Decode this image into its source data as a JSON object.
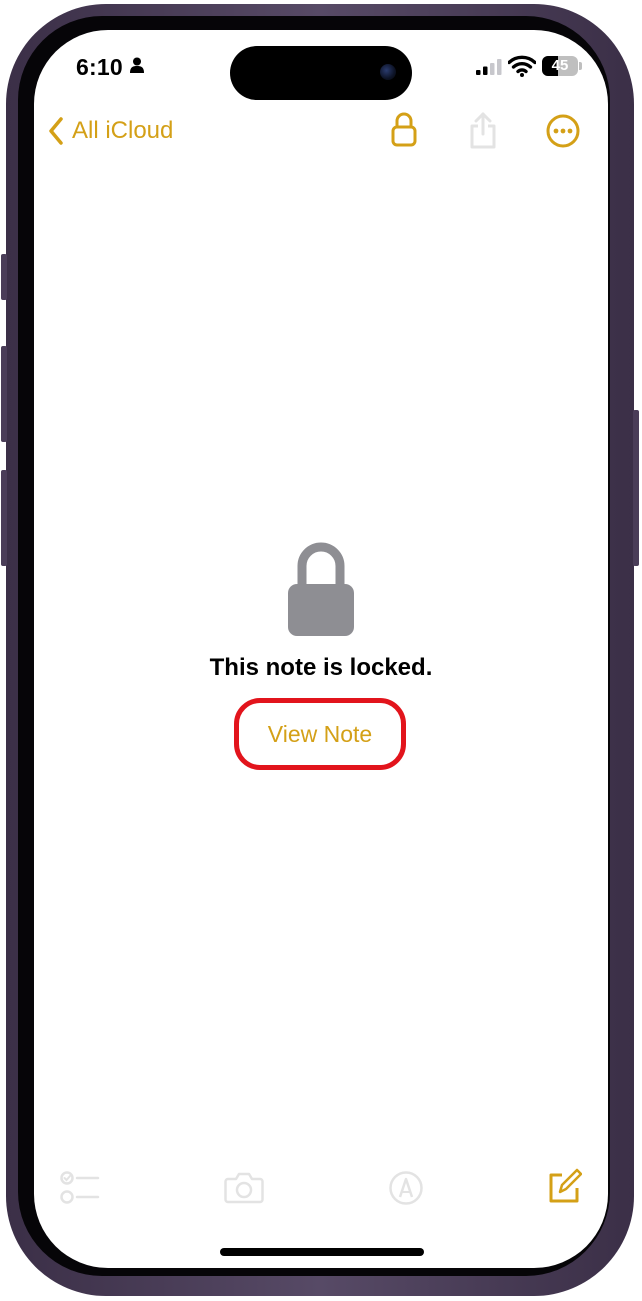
{
  "status_bar": {
    "time": "6:10",
    "battery_level": "45",
    "battery_fraction": 0.45
  },
  "nav": {
    "back_label": "All iCloud",
    "icons": [
      "lock-icon",
      "share-icon",
      "more-icon"
    ]
  },
  "locked": {
    "message": "This note is locked.",
    "view_note_label": "View Note"
  },
  "toolbar": {
    "icons": [
      "checklist-icon",
      "camera-icon",
      "markup-icon",
      "compose-icon"
    ]
  },
  "colors": {
    "accent": "#d4a017",
    "accent_disabled": "#e7e7e7",
    "lock_gray": "#8e8e93",
    "highlight": "#e2141c"
  }
}
